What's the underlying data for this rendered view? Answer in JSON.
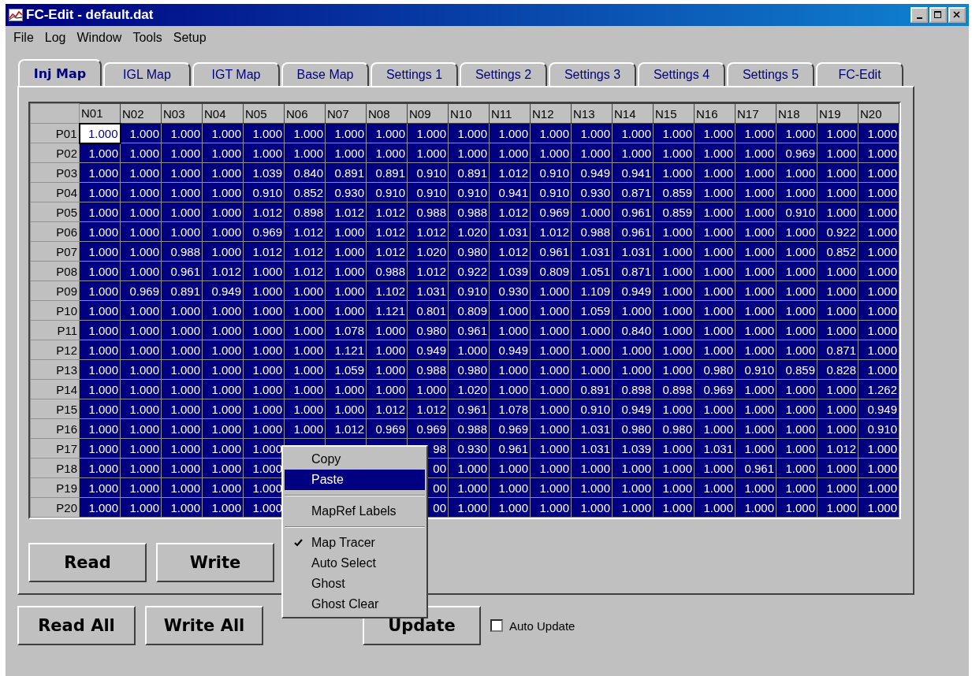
{
  "window": {
    "title": "FC-Edit - default.dat"
  },
  "menu_bar": [
    "File",
    "Log",
    "Window",
    "Tools",
    "Setup"
  ],
  "tabs": [
    {
      "label": "Inj Map",
      "selected": true
    },
    {
      "label": "IGL Map",
      "selected": false
    },
    {
      "label": "IGT Map",
      "selected": false
    },
    {
      "label": "Base Map",
      "selected": false
    },
    {
      "label": "Settings 1",
      "selected": false
    },
    {
      "label": "Settings 2",
      "selected": false
    },
    {
      "label": "Settings 3",
      "selected": false
    },
    {
      "label": "Settings 4",
      "selected": false
    },
    {
      "label": "Settings 5",
      "selected": false
    },
    {
      "label": "FC-Edit",
      "selected": false
    }
  ],
  "grid": {
    "columns": [
      "N01",
      "N02",
      "N03",
      "N04",
      "N05",
      "N06",
      "N07",
      "N08",
      "N09",
      "N10",
      "N11",
      "N12",
      "N13",
      "N14",
      "N15",
      "N16",
      "N17",
      "N18",
      "N19",
      "N20"
    ],
    "rows": [
      {
        "label": "P01",
        "cells": [
          {
            "value": "1.000",
            "focused": true
          },
          "1.000",
          "1.000",
          "1.000",
          "1.000",
          "1.000",
          "1.000",
          "1.000",
          "1.000",
          "1.000",
          "1.000",
          "1.000",
          "1.000",
          "1.000",
          "1.000",
          "1.000",
          "1.000",
          "1.000",
          "1.000",
          "1.000"
        ]
      },
      {
        "label": "P02",
        "cells": [
          "1.000",
          "1.000",
          "1.000",
          "1.000",
          "1.000",
          "1.000",
          "1.000",
          "1.000",
          "1.000",
          "1.000",
          "1.000",
          "1.000",
          "1.000",
          "1.000",
          "1.000",
          "1.000",
          "1.000",
          "0.969",
          "1.000",
          "1.000"
        ]
      },
      {
        "label": "P03",
        "cells": [
          "1.000",
          "1.000",
          "1.000",
          "1.000",
          "1.039",
          "0.840",
          "0.891",
          "0.891",
          "0.910",
          "0.891",
          "1.012",
          "0.910",
          "0.949",
          "0.941",
          "1.000",
          "1.000",
          "1.000",
          "1.000",
          "1.000",
          "1.000"
        ]
      },
      {
        "label": "P04",
        "cells": [
          "1.000",
          "1.000",
          "1.000",
          "1.000",
          "0.910",
          "0.852",
          "0.930",
          "0.910",
          "0.910",
          "0.910",
          "0.941",
          "0.910",
          "0.930",
          "0.871",
          "0.859",
          "1.000",
          "1.000",
          "1.000",
          "1.000",
          "1.000"
        ]
      },
      {
        "label": "P05",
        "cells": [
          "1.000",
          "1.000",
          "1.000",
          "1.000",
          "1.012",
          "0.898",
          "1.012",
          "1.012",
          "0.988",
          "0.988",
          "1.012",
          "0.969",
          "1.000",
          "0.961",
          "0.859",
          "1.000",
          "1.000",
          "0.910",
          "1.000",
          "1.000"
        ]
      },
      {
        "label": "P06",
        "cells": [
          "1.000",
          "1.000",
          "1.000",
          "1.000",
          "0.969",
          "1.012",
          "1.000",
          "1.012",
          "1.012",
          "1.020",
          "1.031",
          "1.012",
          "0.988",
          "0.961",
          "1.000",
          "1.000",
          "1.000",
          "1.000",
          "0.922",
          "1.000"
        ]
      },
      {
        "label": "P07",
        "cells": [
          "1.000",
          "1.000",
          "0.988",
          "1.000",
          "1.012",
          "1.012",
          "1.000",
          "1.012",
          "1.020",
          "0.980",
          "1.012",
          "0.961",
          "1.031",
          "1.031",
          "1.000",
          "1.000",
          "1.000",
          "1.000",
          "0.852",
          "1.000"
        ]
      },
      {
        "label": "P08",
        "cells": [
          "1.000",
          "1.000",
          "0.961",
          "1.012",
          "1.000",
          "1.012",
          "1.000",
          "0.988",
          "1.012",
          "0.922",
          "1.039",
          "0.809",
          "1.051",
          "0.871",
          "1.000",
          "1.000",
          "1.000",
          "1.000",
          "1.000",
          "1.000"
        ]
      },
      {
        "label": "P09",
        "cells": [
          "1.000",
          "0.969",
          "0.891",
          "0.949",
          "1.000",
          "1.000",
          "1.000",
          "1.102",
          "1.031",
          "0.910",
          "0.930",
          "1.000",
          "1.109",
          "0.949",
          "1.000",
          "1.000",
          "1.000",
          "1.000",
          "1.000",
          "1.000"
        ]
      },
      {
        "label": "P10",
        "cells": [
          "1.000",
          "1.000",
          "1.000",
          "1.000",
          "1.000",
          "1.000",
          "1.000",
          "1.121",
          "0.801",
          "0.809",
          "1.000",
          "1.000",
          "1.059",
          "1.000",
          "1.000",
          "1.000",
          "1.000",
          "1.000",
          "1.000",
          "1.000"
        ]
      },
      {
        "label": "P11",
        "cells": [
          "1.000",
          "1.000",
          "1.000",
          "1.000",
          "1.000",
          "1.000",
          "1.078",
          "1.000",
          "0.980",
          "0.961",
          "1.000",
          "1.000",
          "1.000",
          "0.840",
          "1.000",
          "1.000",
          "1.000",
          "1.000",
          "1.000",
          "1.000"
        ]
      },
      {
        "label": "P12",
        "cells": [
          "1.000",
          "1.000",
          "1.000",
          "1.000",
          "1.000",
          "1.000",
          "1.121",
          "1.000",
          "0.949",
          "1.000",
          "0.949",
          "1.000",
          "1.000",
          "1.000",
          "1.000",
          "1.000",
          "1.000",
          "1.000",
          "0.871",
          "1.000"
        ]
      },
      {
        "label": "P13",
        "cells": [
          "1.000",
          "1.000",
          "1.000",
          "1.000",
          "1.000",
          "1.000",
          "1.059",
          "1.000",
          "0.988",
          "0.980",
          "1.000",
          "1.000",
          "1.000",
          "1.000",
          "1.000",
          "0.980",
          "0.910",
          "0.859",
          "0.828",
          "1.000"
        ]
      },
      {
        "label": "P14",
        "cells": [
          "1.000",
          "1.000",
          "1.000",
          "1.000",
          "1.000",
          "1.000",
          "1.000",
          "1.000",
          "1.000",
          "1.020",
          "1.000",
          "1.000",
          "0.891",
          "0.898",
          "0.898",
          "0.969",
          "1.000",
          "1.000",
          "1.000",
          "1.262"
        ]
      },
      {
        "label": "P15",
        "cells": [
          "1.000",
          "1.000",
          "1.000",
          "1.000",
          "1.000",
          "1.000",
          "1.000",
          "1.012",
          "1.012",
          "0.961",
          "1.078",
          "1.000",
          "0.910",
          "0.949",
          "1.000",
          "1.000",
          "1.000",
          "1.000",
          "1.000",
          "0.949"
        ]
      },
      {
        "label": "P16",
        "cells": [
          "1.000",
          "1.000",
          "1.000",
          "1.000",
          "1.000",
          "1.000",
          "1.012",
          "0.969",
          "0.969",
          "0.988",
          "0.969",
          "1.000",
          "1.031",
          "0.980",
          "0.980",
          "1.000",
          "1.000",
          "1.000",
          "1.000",
          "0.910"
        ]
      },
      {
        "label": "P17",
        "cells": [
          "1.000",
          "1.000",
          "1.000",
          "1.000",
          "1.000",
          null,
          null,
          null,
          "98",
          "0.930",
          "0.961",
          "1.000",
          "1.031",
          "1.039",
          "1.000",
          "1.031",
          "1.000",
          "1.000",
          "1.012",
          "1.000"
        ]
      },
      {
        "label": "P18",
        "cells": [
          "1.000",
          "1.000",
          "1.000",
          "1.000",
          "1.000",
          null,
          null,
          null,
          "00",
          "1.000",
          "1.000",
          "1.000",
          "1.000",
          "1.000",
          "1.000",
          "1.000",
          "0.961",
          "1.000",
          "1.000",
          "1.000"
        ]
      },
      {
        "label": "P19",
        "cells": [
          "1.000",
          "1.000",
          "1.000",
          "1.000",
          "1.000",
          null,
          null,
          null,
          "00",
          "1.000",
          "1.000",
          "1.000",
          "1.000",
          "1.000",
          "1.000",
          "1.000",
          "1.000",
          "1.000",
          "1.000",
          "1.000"
        ]
      },
      {
        "label": "P20",
        "cells": [
          "1.000",
          "1.000",
          "1.000",
          "1.000",
          "1.000",
          null,
          null,
          null,
          "00",
          "1.000",
          "1.000",
          "1.000",
          "1.000",
          "1.000",
          "1.000",
          "1.000",
          "1.000",
          "1.000",
          "1.000",
          "1.000"
        ]
      }
    ]
  },
  "panel_buttons": [
    "Read",
    "Write"
  ],
  "bottom_buttons": [
    "Read All",
    "Write All"
  ],
  "update_button": "Update",
  "auto_update": {
    "label": "Auto Update",
    "checked": false
  },
  "context_menu": [
    {
      "kind": "item",
      "label": "Copy",
      "selected": false,
      "checked": false
    },
    {
      "kind": "item",
      "label": "Paste",
      "selected": true,
      "checked": false
    },
    {
      "kind": "separator"
    },
    {
      "kind": "item",
      "label": "MapRef Labels",
      "selected": false,
      "checked": false
    },
    {
      "kind": "separator"
    },
    {
      "kind": "item",
      "label": "Map Tracer",
      "selected": false,
      "checked": true
    },
    {
      "kind": "item",
      "label": "Auto Select",
      "selected": false,
      "checked": false
    },
    {
      "kind": "item",
      "label": "Ghost",
      "selected": false,
      "checked": false
    },
    {
      "kind": "item",
      "label": "Ghost Clear",
      "selected": false,
      "checked": false
    }
  ]
}
